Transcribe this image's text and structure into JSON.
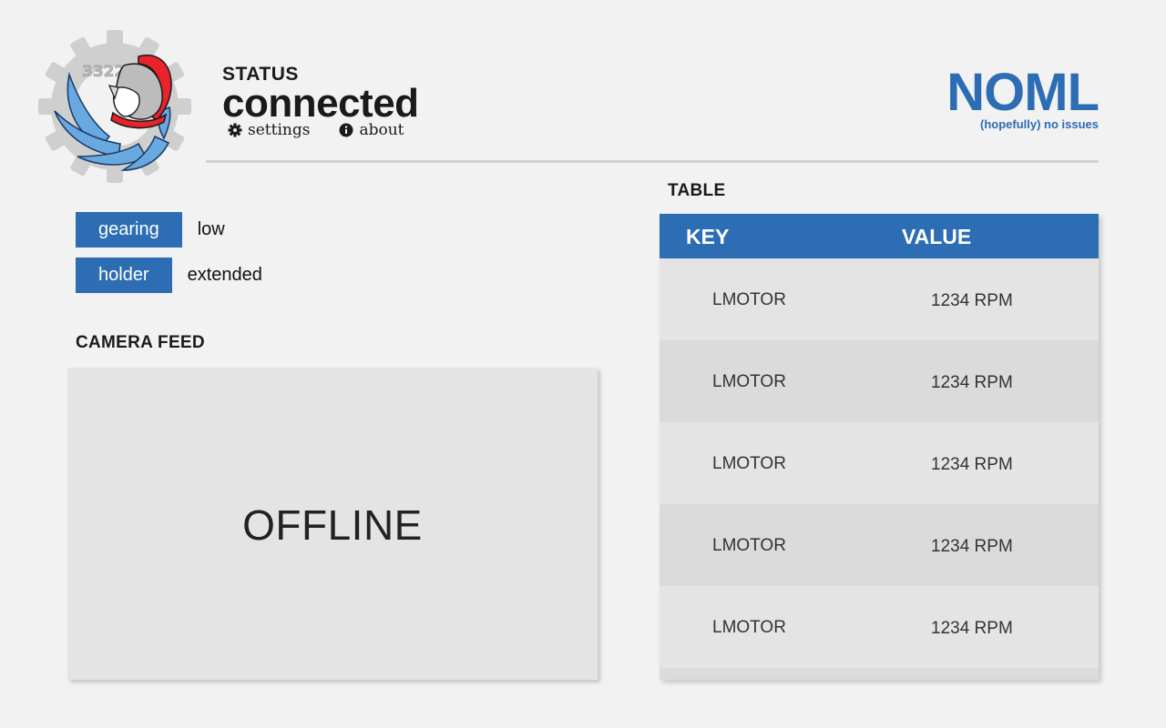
{
  "header": {
    "status_label": "STATUS",
    "status_value": "connected",
    "links": [
      {
        "label": "settings",
        "icon": "gear-icon"
      },
      {
        "label": "about",
        "icon": "info-icon"
      }
    ],
    "brand_name": "NOML",
    "brand_tagline": "(hopefully) no issues",
    "logo_number": "3322"
  },
  "controls": [
    {
      "name": "gearing",
      "value": "low"
    },
    {
      "name": "holder",
      "value": "extended"
    }
  ],
  "camera": {
    "title": "CAMERA FEED",
    "status": "OFFLINE"
  },
  "table": {
    "title": "TABLE",
    "columns": [
      "KEY",
      "VALUE"
    ],
    "rows": [
      {
        "key": "LMOTOR",
        "value": "1234 RPM"
      },
      {
        "key": "LMOTOR",
        "value": "1234 RPM"
      },
      {
        "key": "LMOTOR",
        "value": "1234 RPM"
      },
      {
        "key": "LMOTOR",
        "value": "1234 RPM"
      },
      {
        "key": "LMOTOR",
        "value": "1234 RPM"
      }
    ]
  },
  "colors": {
    "accent": "#2c6db3",
    "background": "#f2f2f2",
    "panel": "#e4e4e4"
  }
}
